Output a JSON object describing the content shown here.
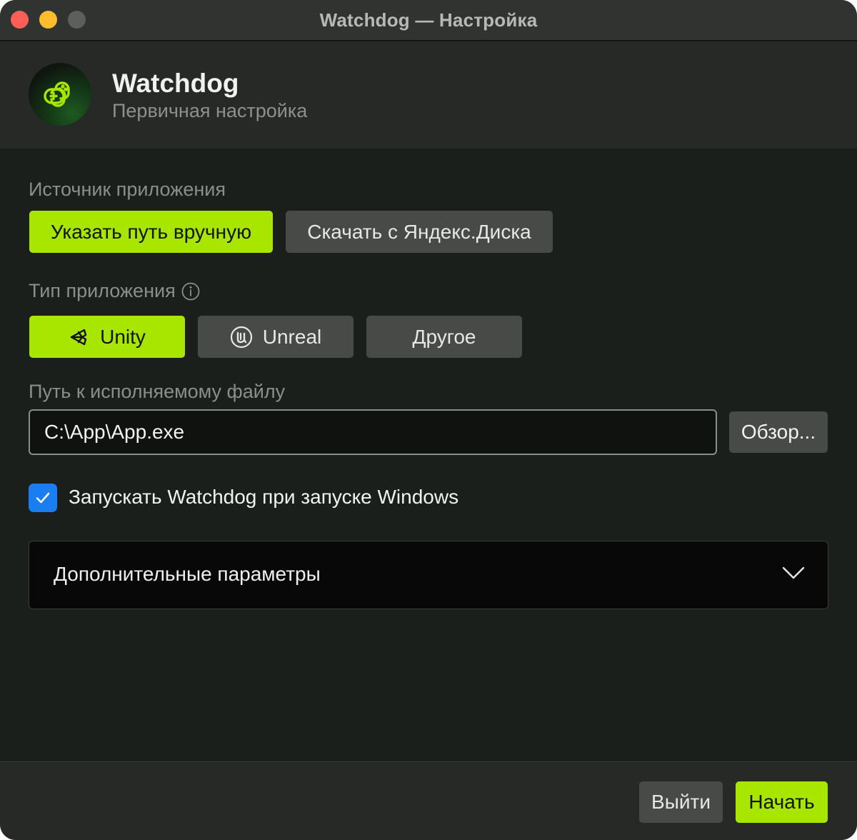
{
  "window": {
    "title": "Watchdog — Настройка"
  },
  "header": {
    "app_name": "Watchdog",
    "subtitle": "Первичная настройка"
  },
  "source": {
    "label": "Источник приложения",
    "manual_label": "Указать путь вручную",
    "download_label": "Скачать с Яндекс.Диска",
    "selected": "manual"
  },
  "app_type": {
    "label": "Тип приложения",
    "options": [
      "Unity",
      "Unreal",
      "Другое"
    ],
    "selected": "Unity"
  },
  "exe_path": {
    "label": "Путь к исполняемому файлу",
    "value": "C:\\App\\App.exe",
    "browse_label": "Обзор..."
  },
  "autostart": {
    "label": "Запускать Watchdog при запуске Windows",
    "checked": true
  },
  "advanced": {
    "label": "Дополнительные параметры",
    "expanded": false
  },
  "footer": {
    "exit_label": "Выйти",
    "start_label": "Начать"
  },
  "colors": {
    "accent": "#a8e600",
    "checkbox": "#1a7ef2",
    "background": "#1b1f1b"
  }
}
